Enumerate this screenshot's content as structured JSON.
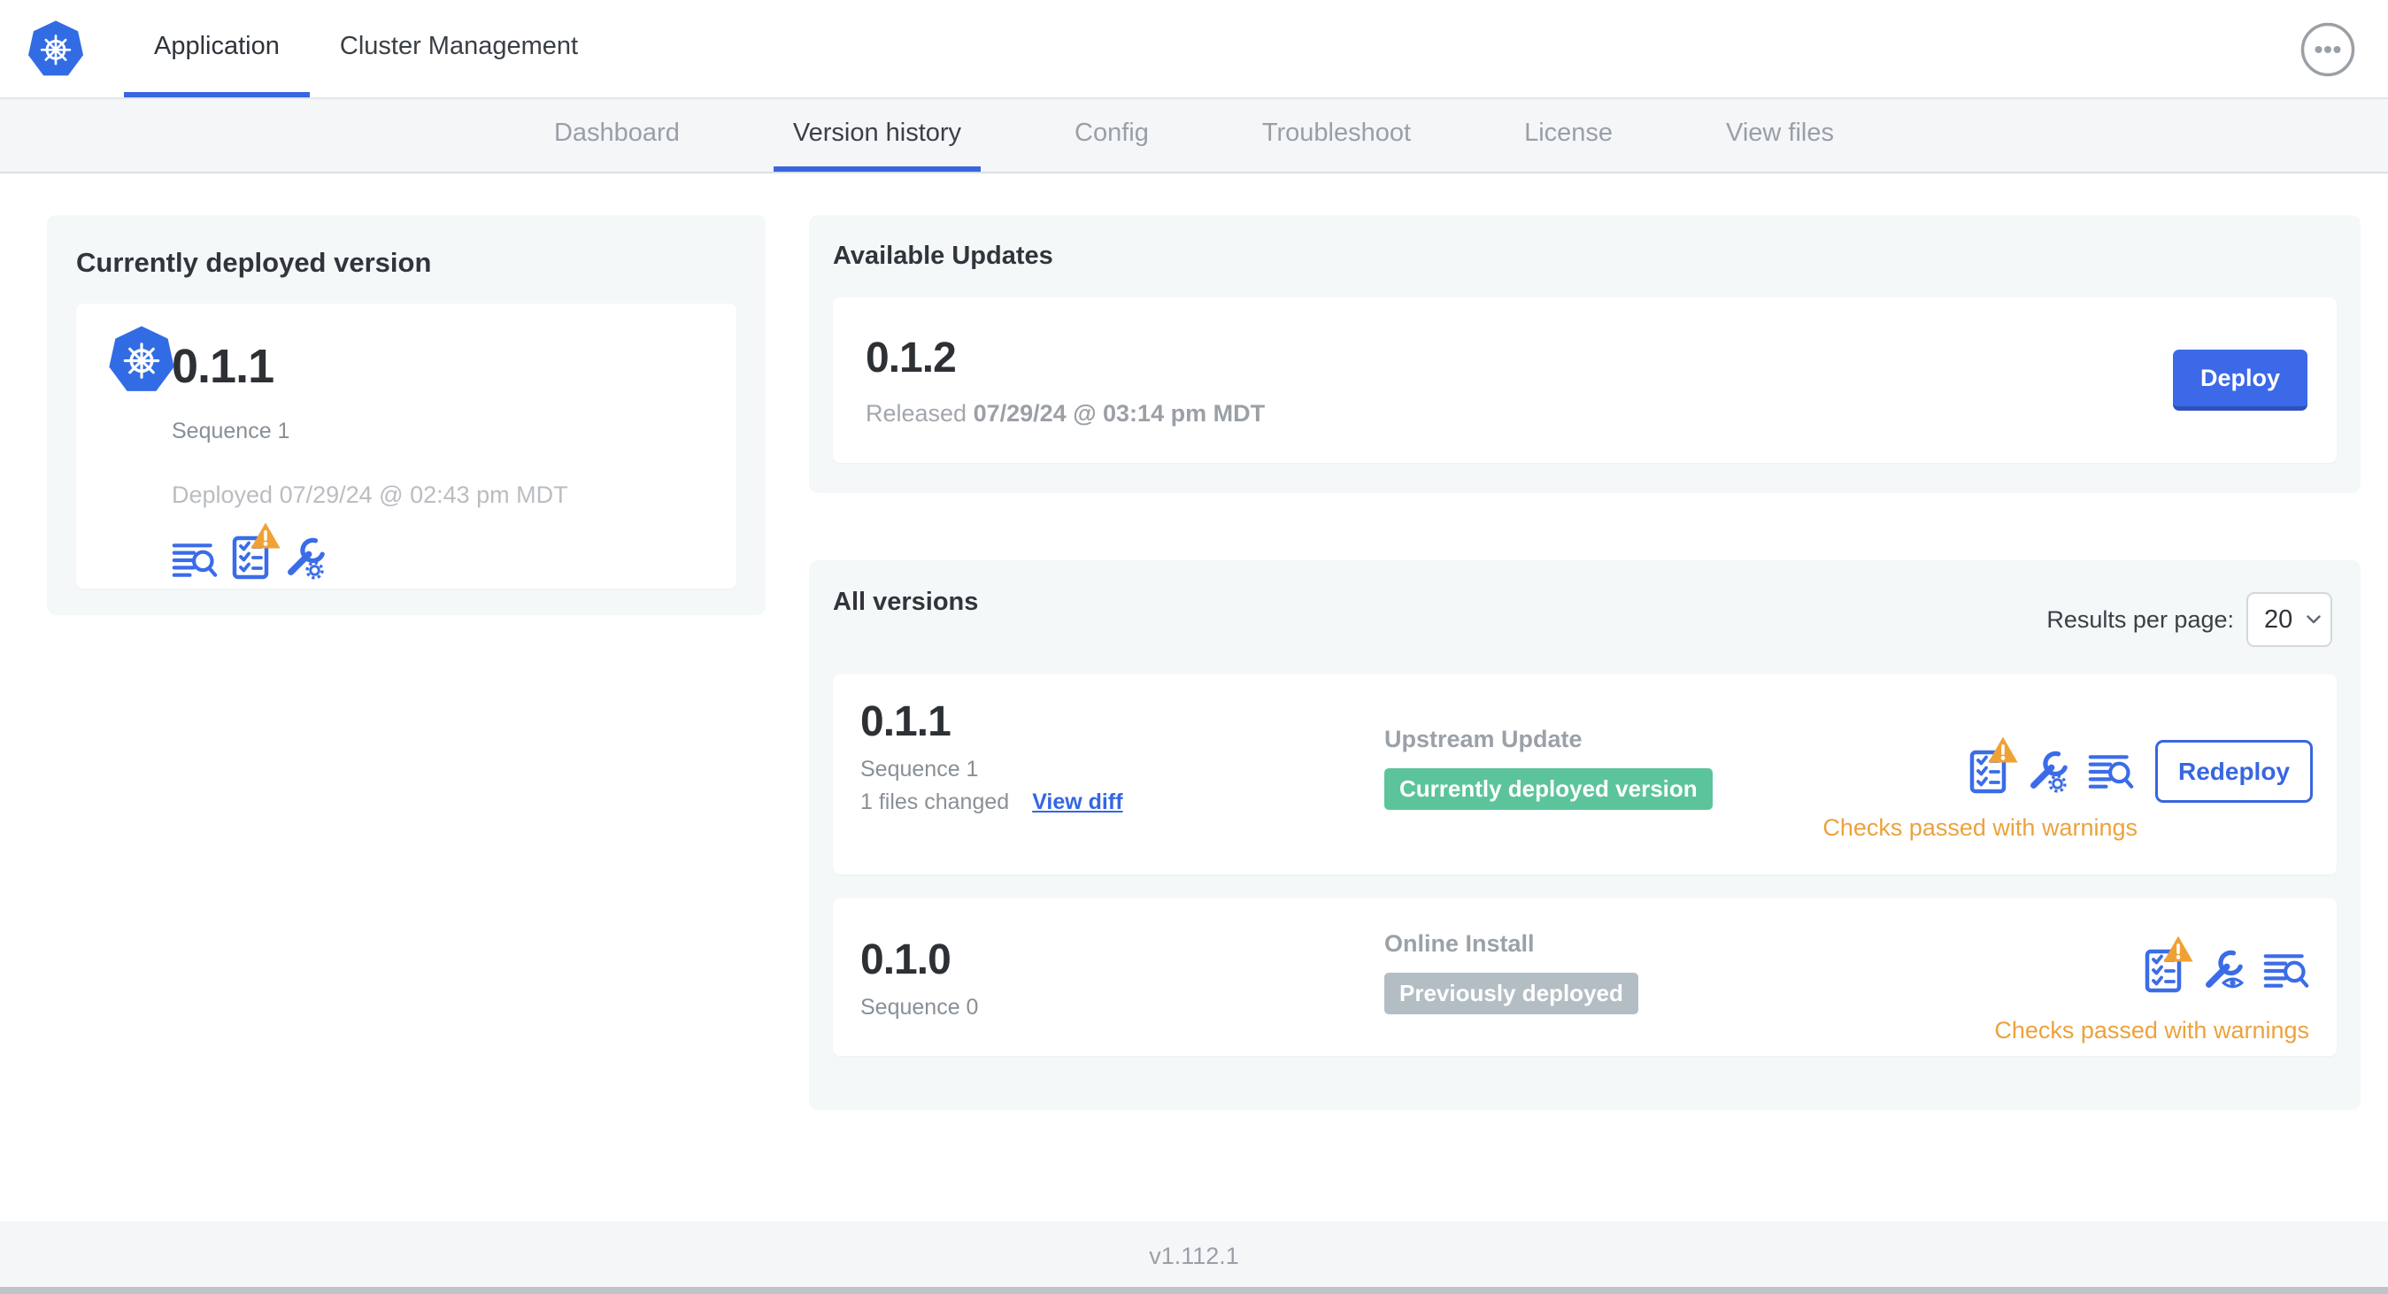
{
  "header": {
    "tabs": [
      {
        "label": "Application"
      },
      {
        "label": "Cluster Management"
      }
    ],
    "active_tab": "Application",
    "more_icon": "ellipsis-icon"
  },
  "subnav": {
    "tabs": [
      {
        "label": "Dashboard"
      },
      {
        "label": "Version history"
      },
      {
        "label": "Config"
      },
      {
        "label": "Troubleshoot"
      },
      {
        "label": "License"
      },
      {
        "label": "View files"
      }
    ],
    "active_tab": "Version history"
  },
  "current_version": {
    "title": "Currently deployed version",
    "version": "0.1.1",
    "sequence": "Sequence 1",
    "deployed": "Deployed 07/29/24 @ 02:43 pm MDT",
    "icons": [
      "diff-search-icon",
      "preflight-checklist-warning-icon",
      "wrench-gear-icon"
    ]
  },
  "available_updates": {
    "title": "Available Updates",
    "version": "0.1.2",
    "released_prefix": "Released",
    "released_date": "07/29/24 @ 03:14 pm MDT",
    "deploy_label": "Deploy"
  },
  "all_versions": {
    "title": "All versions",
    "results_per_page_label": "Results per page:",
    "results_per_page_value": "20",
    "rows": [
      {
        "version": "0.1.1",
        "sequence": "Sequence 1",
        "files_changed": "1 files changed",
        "view_diff": "View diff",
        "source": "Upstream Update",
        "badge": "Currently deployed version",
        "badge_color": "#5cc49a",
        "action": "Redeploy",
        "status": "Checks passed with warnings",
        "icons": [
          "preflight-checklist-warning-icon",
          "wrench-gear-icon",
          "diff-search-icon"
        ]
      },
      {
        "version": "0.1.0",
        "sequence": "Sequence 0",
        "source": "Online Install",
        "badge": "Previously deployed",
        "badge_color": "#b3bec4",
        "status": "Checks passed with warnings",
        "icons": [
          "preflight-checklist-warning-icon",
          "wrench-eye-icon",
          "diff-search-icon"
        ]
      }
    ]
  },
  "footer": {
    "version": "v1.112.1"
  },
  "colors": {
    "accent_blue": "#3b6ce8",
    "kubernetes_blue": "#326ce5",
    "deployed_badge_green": "#5cc49a",
    "previous_badge_gray": "#b3bec4",
    "warning_text_orange": "#eca23c",
    "warning_triangle_amber": "#f0a135",
    "card_background": "#f5f8f9"
  }
}
